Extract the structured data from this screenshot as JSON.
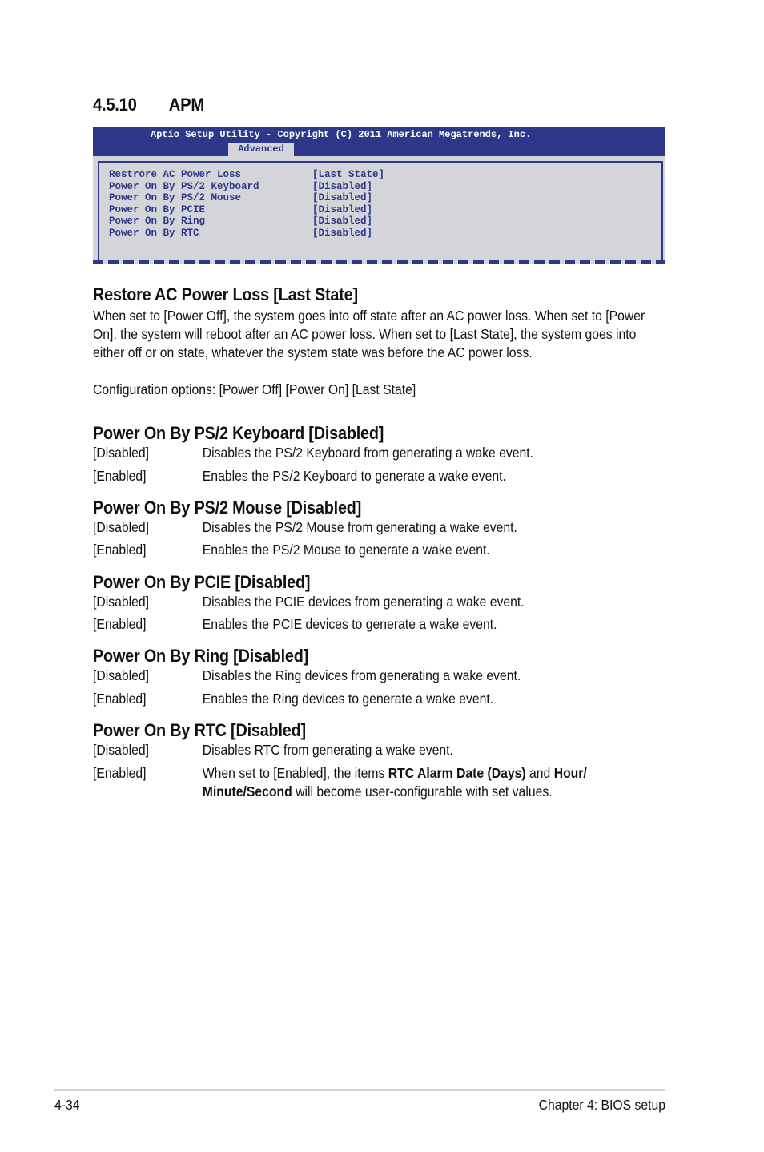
{
  "section": {
    "number": "4.5.10",
    "title": "APM"
  },
  "bios": {
    "title": "Aptio Setup Utility - Copyright (C) 2011 American Megatrends, Inc.",
    "active_tab": "Advanced",
    "colors": {
      "header_bg": "#2e388b",
      "panel_bg": "#d4d5d8",
      "text": "#2e388b"
    },
    "items": [
      {
        "label": "Restrore AC Power Loss",
        "value": "[Last State]"
      },
      {
        "label": "Power On By PS/2 Keyboard",
        "value": "[Disabled]"
      },
      {
        "label": "Power On By PS/2 Mouse",
        "value": "[Disabled]"
      },
      {
        "label": "Power On By PCIE",
        "value": "[Disabled]"
      },
      {
        "label": "Power On By Ring",
        "value": "[Disabled]"
      },
      {
        "label": "Power On By RTC",
        "value": "[Disabled]"
      }
    ]
  },
  "sections": [
    {
      "heading": "Restore AC Power Loss [Last State]",
      "body": "When set to [Power Off], the system goes into off state after an AC power loss. When set to [Power On], the system will reboot after an AC power loss. When set to [Last State], the system goes into either off or on state, whatever the system state was before the AC power loss.",
      "config": "Configuration options: [Power Off] [Power On] [Last State]"
    },
    {
      "heading": "Power On By PS/2 Keyboard [Disabled]",
      "options": [
        {
          "key": "[Disabled]",
          "desc": "Disables the PS/2 Keyboard from generating a wake event."
        },
        {
          "key": "[Enabled]",
          "desc": "Enables the PS/2 Keyboard to generate a wake event."
        }
      ]
    },
    {
      "heading": "Power On By PS/2 Mouse [Disabled]",
      "options": [
        {
          "key": "[Disabled]",
          "desc": "Disables the PS/2 Mouse from generating a wake event."
        },
        {
          "key": "[Enabled]",
          "desc": "Enables the PS/2 Mouse to generate a wake event."
        }
      ]
    },
    {
      "heading": "Power On By PCIE [Disabled]",
      "options": [
        {
          "key": "[Disabled]",
          "desc": "Disables the PCIE devices from generating a wake event."
        },
        {
          "key": "[Enabled]",
          "desc": "Enables the PCIE devices to generate a wake event."
        }
      ]
    },
    {
      "heading": "Power On By Ring [Disabled]",
      "options": [
        {
          "key": "[Disabled]",
          "desc": "Disables the Ring devices from generating a wake event."
        },
        {
          "key": "[Enabled]",
          "desc": "Enables the Ring devices to generate a wake event."
        }
      ]
    },
    {
      "heading": "Power On By RTC [Disabled]",
      "options": [
        {
          "key": "[Disabled]",
          "desc": "Disables RTC from generating a wake event."
        },
        {
          "key": "[Enabled]",
          "desc_parts": {
            "p1": "When set to [Enabled], the items ",
            "b1": "RTC Alarm Date (Days)",
            "p2": " and ",
            "b2": "Hour/",
            "b3": "Minute/Second",
            "p3": " will become user-configurable with set values."
          }
        }
      ]
    }
  ],
  "footer": {
    "page": "4-34",
    "chapter": "Chapter 4: BIOS setup"
  }
}
